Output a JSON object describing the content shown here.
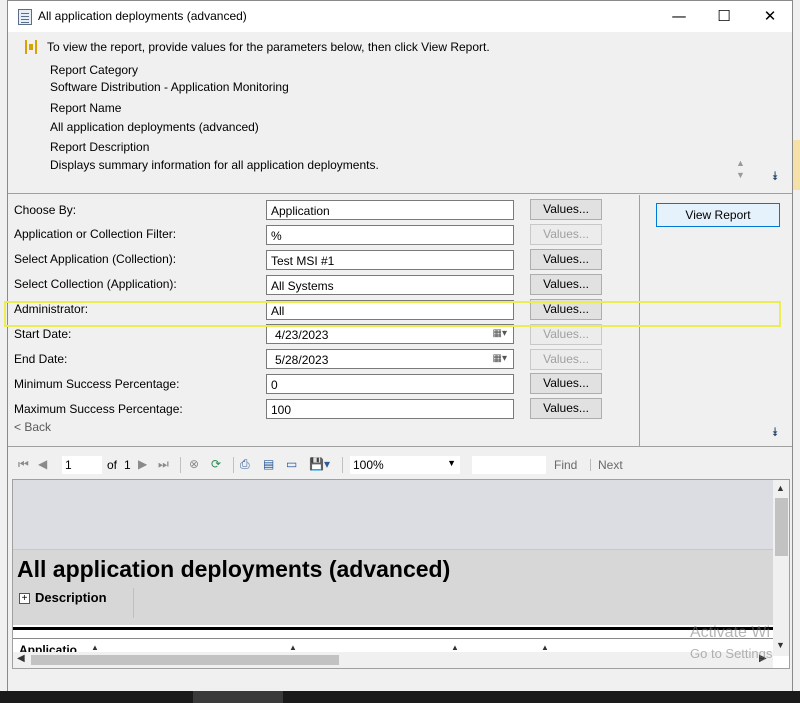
{
  "window": {
    "title": "All application deployments (advanced)",
    "minimize_glyph": "—",
    "maximize_glyph": "☐",
    "close_glyph": "✕"
  },
  "info": {
    "instruction": "To view the report, provide values for the parameters below, then click View Report.",
    "category_label": "Report Category",
    "category_value": "Software Distribution - Application Monitoring",
    "name_label": "Report Name",
    "name_value": "All application deployments (advanced)",
    "description_label": "Report Description",
    "description_value": "Displays summary information for all application deployments."
  },
  "params": [
    {
      "label": "Choose By:",
      "value": "Application",
      "button": "Values...",
      "enabled": true
    },
    {
      "label": "Application or Collection Filter:",
      "value": "%",
      "button": "Values...",
      "enabled": false
    },
    {
      "label": "Select Application (Collection):",
      "value": "Test MSI #1",
      "button": "Values...",
      "enabled": true
    },
    {
      "label": "Select Collection (Application):",
      "value": "All Systems",
      "button": "Values...",
      "enabled": true
    },
    {
      "label": "Administrator:",
      "value": "All",
      "button": "Values...",
      "enabled": true
    },
    {
      "label": "Start Date:",
      "value": "4/23/2023",
      "button": "Values...",
      "enabled": false
    },
    {
      "label": "End Date:",
      "value": "5/28/2023",
      "button": "Values...",
      "enabled": false
    },
    {
      "label": "Minimum Success Percentage:",
      "value": "0",
      "button": "Values...",
      "enabled": true
    },
    {
      "label": "Maximum Success Percentage:",
      "value": "100",
      "button": "Values...",
      "enabled": true
    }
  ],
  "back_link": "< Back",
  "view_report_button": "View Report",
  "toolbar": {
    "page_current": "1",
    "page_of": "of",
    "page_total": "1",
    "zoom": "100%",
    "find": "Find",
    "next": "Next",
    "separator": "|"
  },
  "report": {
    "title": "All application deployments (advanced)",
    "description_toggle": "Description",
    "first_column": "Applicatio"
  },
  "watermark": {
    "line1": "Activate Wi",
    "line2": "Go to Settings"
  },
  "colors": {
    "accent": "#0078d7",
    "highlight": "#ecec55"
  }
}
